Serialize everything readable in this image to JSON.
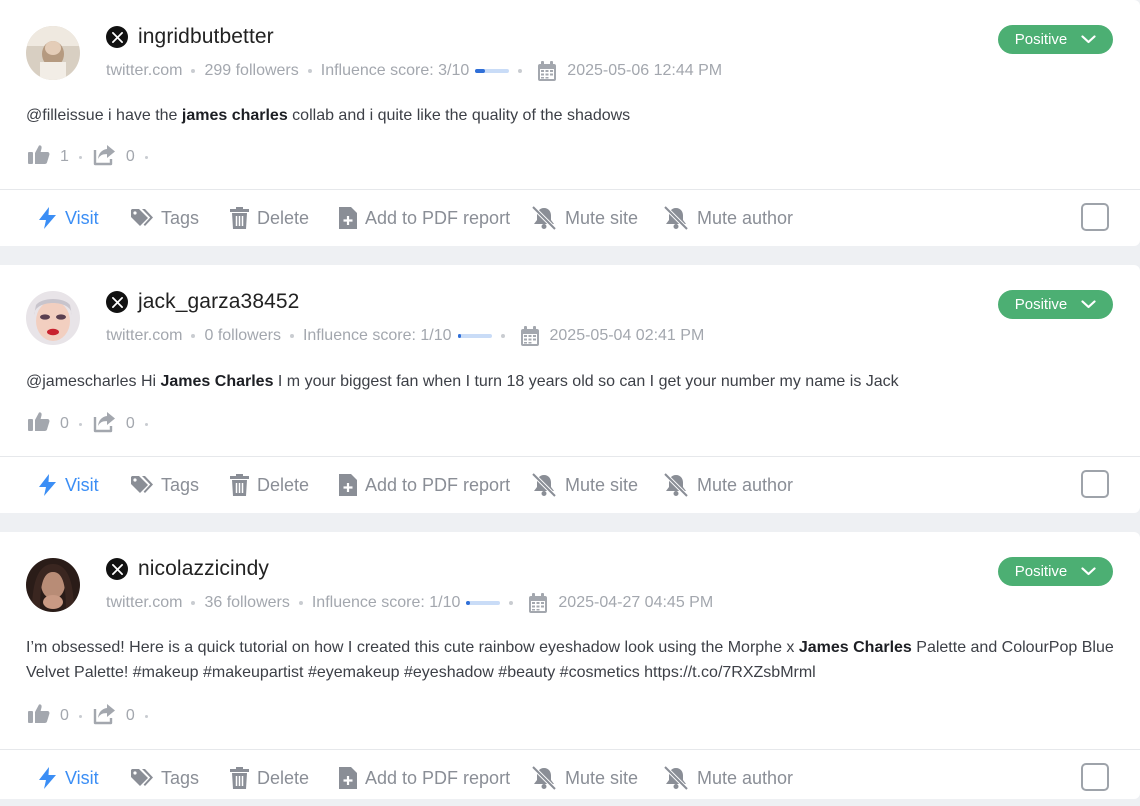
{
  "actions": {
    "visit": "Visit",
    "tags": "Tags",
    "delete": "Delete",
    "add_pdf": "Add to PDF report",
    "mute_site": "Mute site",
    "mute_author": "Mute author"
  },
  "colors": {
    "positive": "#4caf73",
    "visit": "#3b8ef5",
    "score_fill": "#2f6fd8",
    "score_track": "#c9dcf7"
  },
  "mentions": [
    {
      "author": "ingridbutbetter",
      "source_icon": "x-logo-icon",
      "site": "twitter.com",
      "followers": "299 followers",
      "influence": "Influence score: 3/10",
      "influence_fraction": 0.3,
      "date": "2025-05-06 12:44 PM",
      "sentiment": "Positive",
      "text_before": "@filleissue i have the ",
      "text_bold": "james charles",
      "text_after": " collab and i quite like the quality of the shadows",
      "likes": "1",
      "shares": "0"
    },
    {
      "author": "jack_garza38452",
      "source_icon": "x-logo-icon",
      "site": "twitter.com",
      "followers": "0 followers",
      "influence": "Influence score: 1/10",
      "influence_fraction": 0.1,
      "date": "2025-05-04 02:41 PM",
      "sentiment": "Positive",
      "text_before": "@jamescharles Hi ",
      "text_bold": "James Charles",
      "text_after": " I m your biggest fan when I turn 18 years old so can I get your number my name is Jack",
      "likes": "0",
      "shares": "0"
    },
    {
      "author": "nicolazzicindy",
      "source_icon": "x-logo-icon",
      "site": "twitter.com",
      "followers": "36 followers",
      "influence": "Influence score: 1/10",
      "influence_fraction": 0.1,
      "date": "2025-04-27 04:45 PM",
      "sentiment": "Positive",
      "text_before": "I’m obsessed! Here is a quick tutorial on how I created this cute rainbow eyeshadow look using the Morphe x ",
      "text_bold": "James Charles",
      "text_after": " Palette and ColourPop Blue Velvet Palette! #makeup #makeupartist #eyemakeup #eyeshadow #beauty #cosmetics https://t.co/7RXZsbMrml",
      "likes": "0",
      "shares": "0"
    }
  ]
}
